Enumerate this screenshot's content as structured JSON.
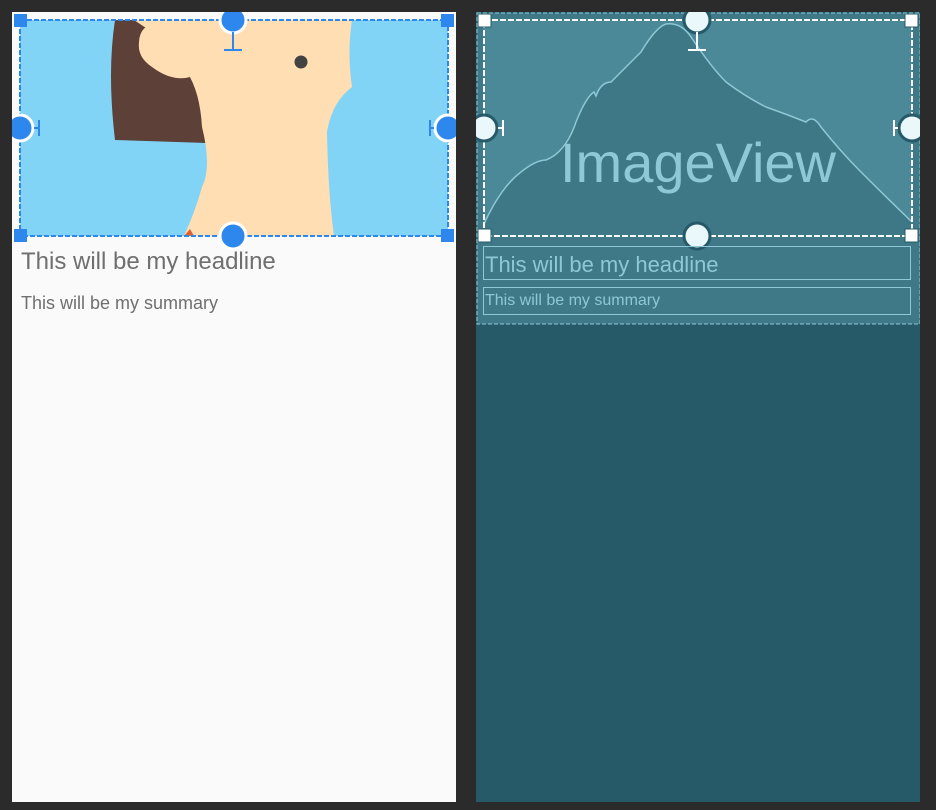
{
  "design": {
    "headline": "This will be my headline",
    "summary": "This will be my summary"
  },
  "blueprint": {
    "image_label": "ImageView",
    "headline": "This will be my headline",
    "summary": "This will be my summary"
  },
  "colors": {
    "editor_background": "#2b2b2b",
    "design_background": "#fafafa",
    "blueprint_background": "#265a69",
    "selection_blue": "#2d87ec",
    "blueprint_line": "#8ec8d6",
    "image_sky": "#82d4f7",
    "image_hair": "#5d4037",
    "image_skin": "#ffdeb3"
  }
}
